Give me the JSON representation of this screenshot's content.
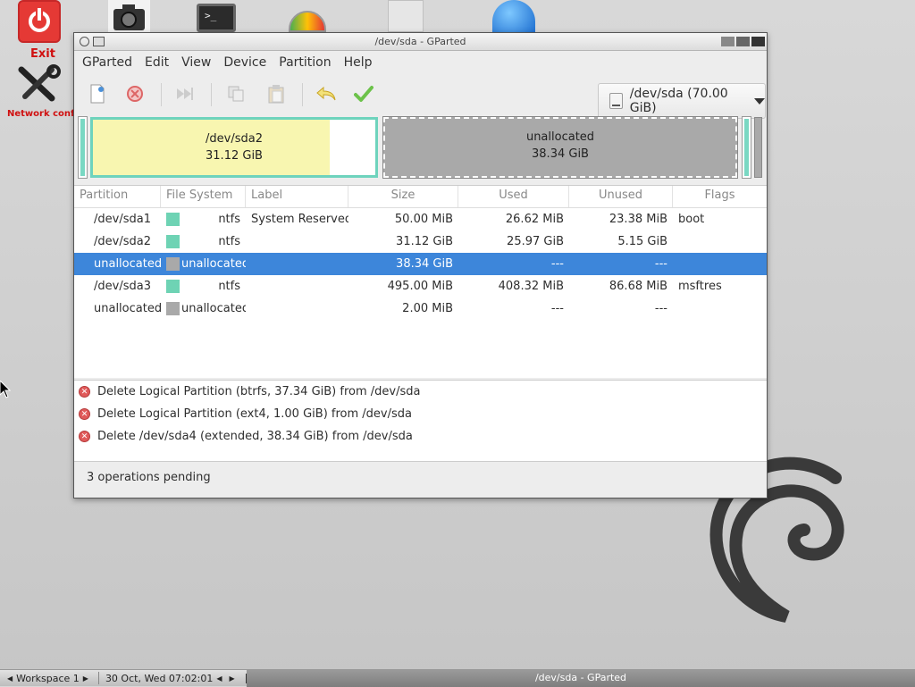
{
  "desktop": {
    "exit_label": "Exit",
    "netconfig_label": "Network config",
    "terminal_glyph": ">_"
  },
  "window": {
    "title": "/dev/sda - GParted"
  },
  "menu": [
    "GParted",
    "Edit",
    "View",
    "Device",
    "Partition",
    "Help"
  ],
  "toolbar": {
    "icons": [
      "new-icon",
      "delete-icon",
      "resize-move-icon",
      "copy-icon",
      "paste-icon",
      "undo-icon",
      "apply-icon"
    ],
    "device": "/dev/sda (70.00 GiB)"
  },
  "diskmap": {
    "sda2_name": "/dev/sda2",
    "sda2_size": "31.12 GiB",
    "unalloc_name": "unallocated",
    "unalloc_size": "38.34 GiB"
  },
  "table": {
    "headers": [
      "Partition",
      "File System",
      "Label",
      "Size",
      "Used",
      "Unused",
      "Flags"
    ],
    "rows": [
      {
        "partition": "/dev/sda1",
        "fs": "ntfs",
        "label": "System Reserved",
        "size": "50.00 MiB",
        "used": "26.62 MiB",
        "unused": "23.38 MiB",
        "flags": "boot"
      },
      {
        "partition": "/dev/sda2",
        "fs": "ntfs",
        "label": "",
        "size": "31.12 GiB",
        "used": "25.97 GiB",
        "unused": "5.15 GiB",
        "flags": ""
      },
      {
        "partition": "unallocated",
        "fs": "unallocated",
        "label": "",
        "size": "38.34 GiB",
        "used": "---",
        "unused": "---",
        "flags": ""
      },
      {
        "partition": "/dev/sda3",
        "fs": "ntfs",
        "label": "",
        "size": "495.00 MiB",
        "used": "408.32 MiB",
        "unused": "86.68 MiB",
        "flags": "msftres"
      },
      {
        "partition": "unallocated",
        "fs": "unallocated",
        "label": "",
        "size": "2.00 MiB",
        "used": "---",
        "unused": "---",
        "flags": ""
      }
    ]
  },
  "colors": {
    "ntfs": "#6ed3b4",
    "unallocated": "#a9a9a9",
    "selection": "#3d86da"
  },
  "operations": [
    "Delete Logical Partition (btrfs, 37.34 GiB) from /dev/sda",
    "Delete Logical Partition (ext4, 1.00 GiB) from /dev/sda",
    "Delete /dev/sda4 (extended, 38.34 GiB) from /dev/sda"
  ],
  "status": "3 operations pending",
  "taskbar": {
    "workspace": "Workspace 1",
    "clock": "30 Oct, Wed 07:02:01",
    "task": "/dev/sda - GParted"
  }
}
